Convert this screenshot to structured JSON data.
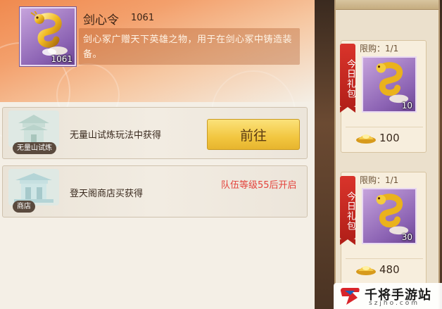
{
  "item": {
    "name": "剑心令",
    "count": "1061",
    "frame_qty": "1061",
    "icon": "golden-dragon-token-icon",
    "description": "剑心冢广赠天下英雄之物，用于在剑心冢中铸造装备。"
  },
  "sources": [
    {
      "label": "无量山试炼",
      "icon": "pavilion-icon",
      "text": "无量山试炼玩法中获得",
      "button_label": "前往"
    },
    {
      "label": "商店",
      "icon": "shop-pavilion-icon",
      "text": "登天阁商店买获得",
      "unlock_text": "队伍等级55后开启"
    }
  ],
  "shop": {
    "ribbon_label": "今日礼包",
    "packs": [
      {
        "limit": "限购：1/1",
        "qty": "10",
        "price": "100",
        "icon": "golden-dragon-token-icon"
      },
      {
        "limit": "限购：1/1",
        "qty": "30",
        "price": "480",
        "icon": "golden-dragon-token-icon"
      }
    ]
  },
  "watermark": {
    "name": "千将手游站",
    "url": "szjho.com"
  },
  "colors": {
    "header_orange": "#f08a4f",
    "goto_yellow": "#f2c640",
    "unlock_red": "#e3433c",
    "frame_purple": "#8b62b3",
    "ribbon_red": "#d9342b"
  }
}
